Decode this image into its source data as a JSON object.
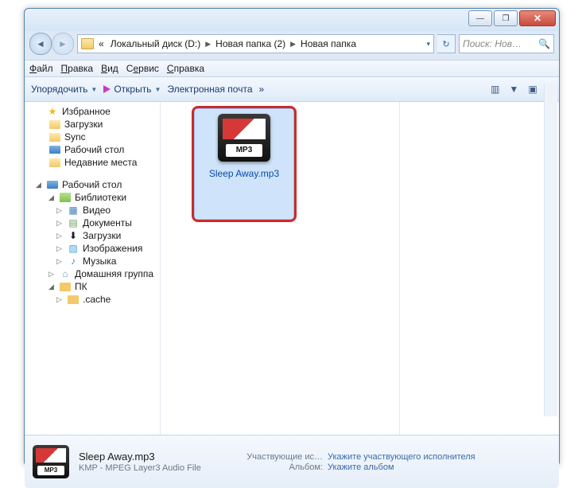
{
  "titlebar": {
    "min": "—",
    "max": "❐",
    "close": "✕"
  },
  "breadcrumb": {
    "back_hint": "«",
    "items": [
      "Локальный диск (D:)",
      "Новая папка (2)",
      "Новая папка"
    ],
    "refresh": "↻",
    "dropdown": "▾"
  },
  "search": {
    "placeholder": "Поиск: Нов…",
    "icon": "🔍"
  },
  "menubar": {
    "file": "Файл",
    "edit": "Правка",
    "view": "Вид",
    "service": "Сервис",
    "help": "Справка"
  },
  "toolbar": {
    "organize": "Упорядочить",
    "open": "Открыть",
    "email": "Электронная почта",
    "overflow": "»",
    "panes": "▥",
    "help": "?"
  },
  "nav": {
    "fav": "Избранное",
    "downloads": "Загрузки",
    "sync": "Sync",
    "desktop": "Рабочий стол",
    "recent": "Недавние места",
    "desktop2": "Рабочий стол",
    "libs": "Библиотеки",
    "video": "Видео",
    "docs": "Документы",
    "docs2": "Загрузки",
    "pics": "Изображения",
    "music": "Музыка",
    "homegroup": "Домашняя группа",
    "pk": "ПК",
    "cache": ".cache"
  },
  "file": {
    "name": "Sleep Away.mp3",
    "thumb_label": "MP3"
  },
  "details": {
    "name": "Sleep Away.mp3",
    "type": "KMP - MPEG Layer3 Audio File",
    "artist_lbl": "Участвующие ис…",
    "artist_val": "Укажите участвующего исполнителя",
    "album_lbl": "Альбом:",
    "album_val": "Укажите альбом"
  }
}
